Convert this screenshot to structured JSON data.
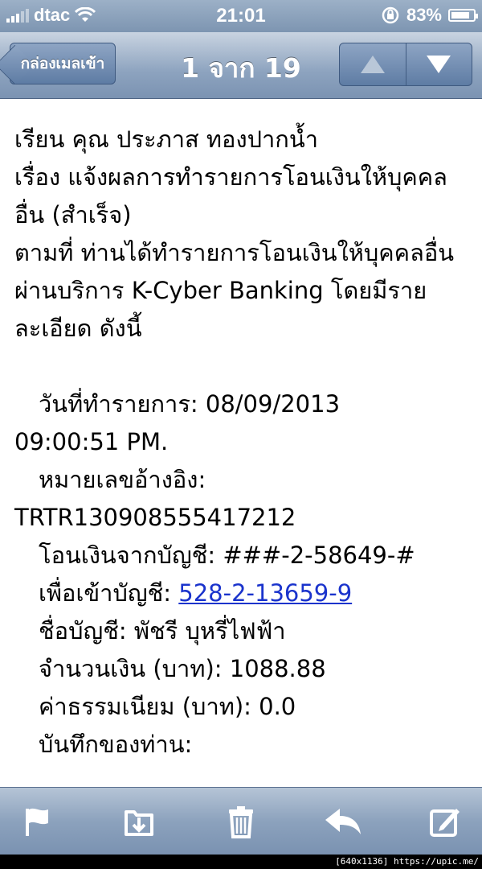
{
  "status_bar": {
    "carrier": "dtac",
    "time": "21:01",
    "battery": "83%",
    "battery_level": 0.83
  },
  "nav": {
    "back_label": "กล่องเมลเข้า",
    "title": "1 จาก 19"
  },
  "message": {
    "line1": "เรียน คุณ ประภาส ทองปากน้ำ",
    "line2": "เรื่อง แจ้งผลการทำรายการโอนเงินให้บุคคล",
    "line3": "อื่น (สำเร็จ)",
    "line4": "ตามที่ ท่านได้ทำรายการโอนเงินให้บุคคลอื่น",
    "line5": "ผ่านบริการ K-Cyber Banking โดยมีราย",
    "line6": "ละเอียด ดังนี้",
    "date_label": "วันที่ทำรายการ: 08/09/2013",
    "date_cont": "09:00:51 PM.",
    "ref_label": "หมายเลขอ้างอิง:",
    "ref_value": "TRTR130908555417212",
    "from_label": "โอนเงินจากบัญชี: ###-2-58649-#",
    "to_label": "เพื่อเข้าบัญชี: ",
    "to_value": "528-2-13659-9",
    "name_label": "ชื่อบัญชี: พัชรี บุหรี่ไฟฟ้า",
    "amount_label": "จำนวนเงิน (บาท): 1088.88",
    "fee_label": "ค่าธรรมเนียม (บาท): 0.0",
    "note_label": "บันทึกของท่าน:"
  },
  "toolbar": {
    "icons": [
      "flag-icon",
      "move-folder-icon",
      "trash-icon",
      "reply-icon",
      "compose-icon"
    ]
  },
  "watermark": "[640x1136] https://upic.me/"
}
